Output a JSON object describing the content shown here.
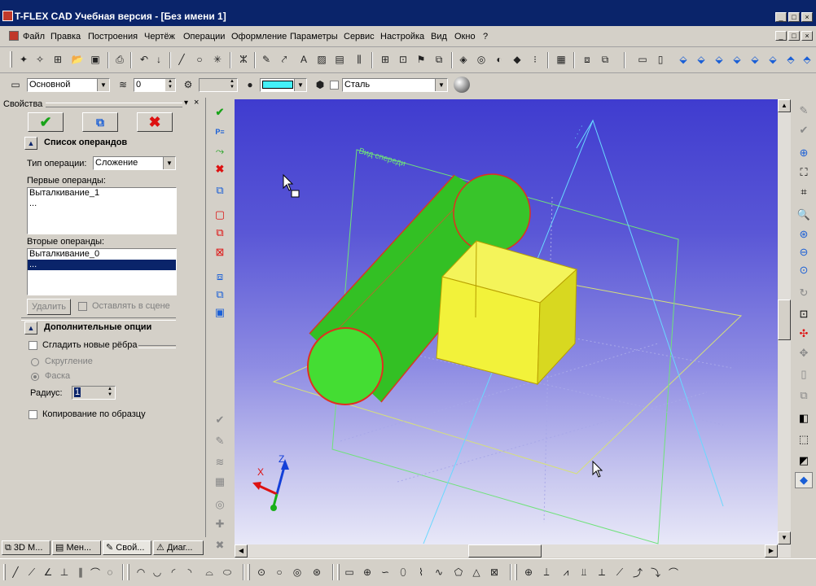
{
  "window": {
    "title": "T-FLEX CAD Учебная версия - [Без имени 1]",
    "controls": [
      "_",
      "□",
      "×"
    ]
  },
  "menu": [
    "Файл",
    "Правка",
    "Построения",
    "Чертёж",
    "Операции",
    "Оформление",
    "Параметры",
    "Сервис",
    "Настройка",
    "Вид",
    "Окно",
    "?"
  ],
  "props_toolbar": {
    "layer": "Основной",
    "level": "0",
    "material": "Сталь"
  },
  "panel": {
    "title": "Свойства",
    "operands_section": "Список операндов",
    "op_type_label": "Тип операции:",
    "op_type_value": "Сложение",
    "first_operands_label": "Первые операнды:",
    "first_operands": [
      "Выталкивание_1",
      "..."
    ],
    "second_operands_label": "Вторые операнды:",
    "second_operands": [
      "Выталкивание_0",
      "..."
    ],
    "delete_button": "Удалить",
    "keep_label": "Оставлять в сцене",
    "extra_section": "Дополнительные опции",
    "smooth_label": "Сгладить новые рёбра",
    "rounding_label": "Скругление",
    "chamfer_label": "Фаска",
    "radius_label": "Радиус:",
    "radius_value": "1",
    "copy_label": "Копирование по образцу"
  },
  "tabs": [
    "3D М...",
    "Мен...",
    "Свой...",
    "Диаг..."
  ],
  "viewport": {
    "plane_label": "Вид спереди",
    "axes": {
      "x": "X",
      "z": "Z"
    },
    "colors": {
      "body": "#35c125",
      "box": "#f2f23a",
      "edge": "#e0301f",
      "plane": "#b8e070"
    }
  }
}
